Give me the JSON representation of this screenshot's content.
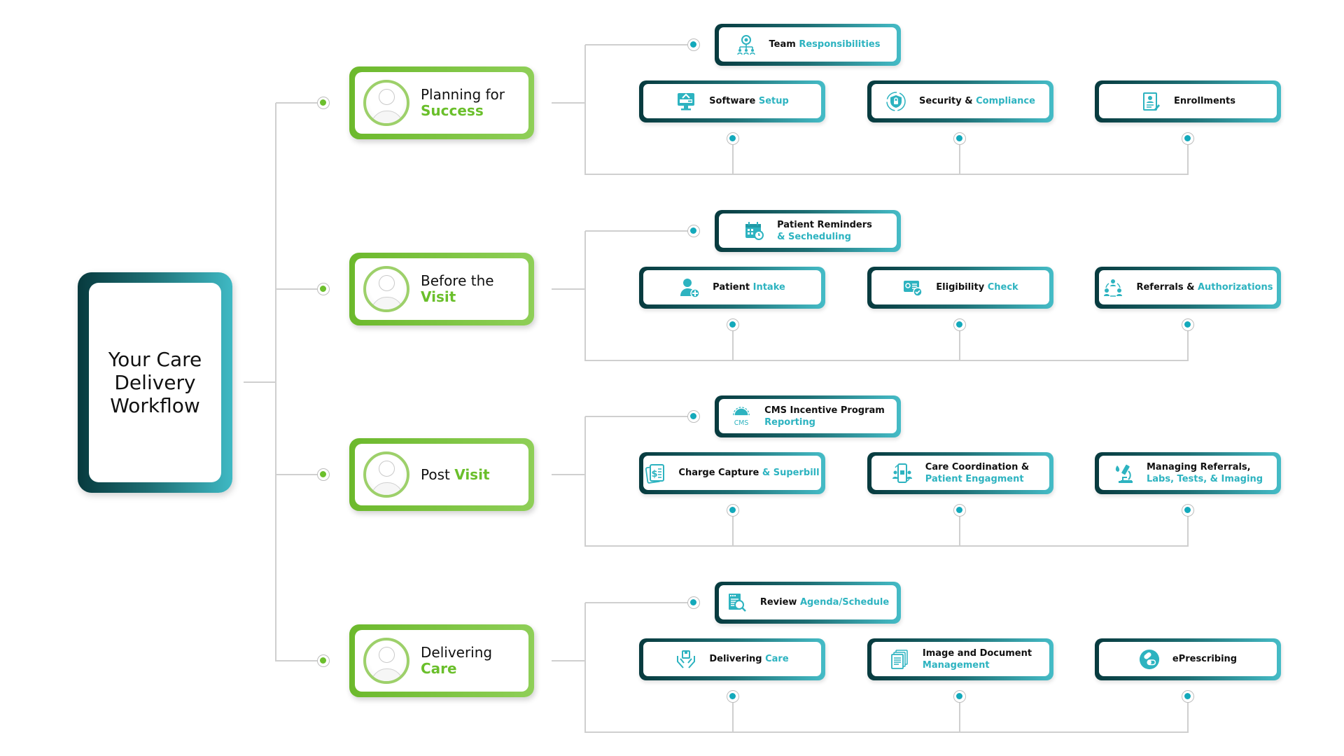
{
  "title": {
    "lines": [
      "Your Care",
      "Delivery",
      "Workflow"
    ]
  },
  "colors": {
    "phase_accent": "#6abf2b",
    "task_accent": "#2db3c0",
    "teal_dark": "#073a3e",
    "teal_light": "#45bcc7"
  },
  "phases": [
    {
      "label_plain": "Planning for",
      "label_accent": "Success",
      "icon": "person-avatar-icon",
      "top_task": {
        "plain": "Team ",
        "accent": "Responsibilities",
        "icon": "team-hierarchy-icon"
      },
      "tasks": [
        {
          "plain": "Software ",
          "accent": "Setup",
          "icon": "monitor-setup-icon"
        },
        {
          "plain": "Security & ",
          "accent": "Compliance",
          "icon": "shield-lock-icon"
        },
        {
          "plain": "Enrollments",
          "accent": "",
          "icon": "enrollment-form-icon"
        }
      ]
    },
    {
      "label_plain": "Before the",
      "label_accent": "Visit",
      "icon": "person-avatar-icon",
      "top_task": {
        "plain": "Patient Reminders",
        "accent": "& Secheduling",
        "icon": "calendar-clock-icon",
        "two_line": true
      },
      "tasks": [
        {
          "plain": "Patient ",
          "accent": "Intake",
          "icon": "user-add-icon"
        },
        {
          "plain": "Eligibility ",
          "accent": "Check",
          "icon": "id-card-check-icon"
        },
        {
          "plain": "Referrals & ",
          "accent": "Authorizations",
          "icon": "referral-network-icon"
        }
      ]
    },
    {
      "label_plain": "Post ",
      "label_accent": "Visit",
      "icon": "person-avatar-icon",
      "top_task": {
        "plain": "CMS Incentive Program",
        "accent": "Reporting",
        "icon": "cms-gear-icon",
        "two_line": true
      },
      "tasks": [
        {
          "plain": "Charge Capture ",
          "accent": "& Superbill",
          "icon": "billing-document-icon"
        },
        {
          "plain": "Care Coordination &",
          "accent": "Patient Engagment",
          "icon": "mobile-care-icon",
          "two_line": true
        },
        {
          "plain": "Managing Referrals,",
          "accent": "Labs, Tests, & Imaging",
          "icon": "microscope-icon",
          "two_line": true
        }
      ]
    },
    {
      "label_plain": "Delivering ",
      "label_accent": "Care",
      "icon": "person-avatar-icon",
      "top_task": {
        "plain": "Review ",
        "accent": "Agenda/Schedule",
        "icon": "document-search-icon"
      },
      "tasks": [
        {
          "plain": "Delivering ",
          "accent": "Care",
          "icon": "hands-care-icon"
        },
        {
          "plain": "Image and Document",
          "accent": "Management",
          "icon": "documents-stack-icon",
          "two_line": true
        },
        {
          "plain": "ePrescribing",
          "accent": "",
          "icon": "pill-capsule-icon"
        }
      ]
    }
  ]
}
